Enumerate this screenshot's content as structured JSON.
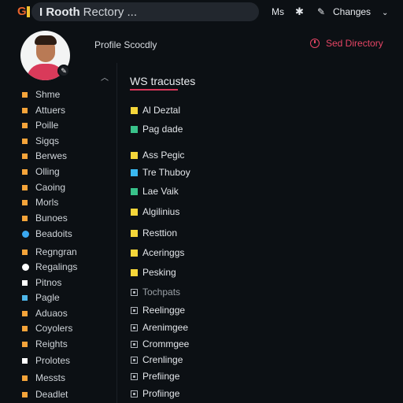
{
  "topbar": {
    "logo_letter": "G",
    "search_bold": "I Rooth",
    "search_rest": "Rectory ...",
    "ms_label": "Ms",
    "gear_icon": "gear-icon",
    "wrench_icon": "wrench-icon",
    "changes_label": "Changes",
    "chevron_icon": "chevron-down-icon"
  },
  "profile": {
    "label": "Profile Scocdly",
    "set_directory": "Sed Directory"
  },
  "sidebar": {
    "items": [
      {
        "label": "Shme",
        "color": "#f5a43a"
      },
      {
        "label": "Attuers",
        "color": "#f5a43a"
      },
      {
        "label": "Poille",
        "color": "#f5a43a"
      },
      {
        "label": "Sigqs",
        "color": "#f5a43a"
      },
      {
        "label": "Berwes",
        "color": "#f5a43a"
      },
      {
        "label": "Olling",
        "color": "#f5a43a"
      },
      {
        "label": "Caoing",
        "color": "#f5a43a"
      },
      {
        "label": "Morls",
        "color": "#f5a43a"
      },
      {
        "label": "Bunoes",
        "color": "#f5a43a"
      },
      {
        "label": "Beadoits",
        "color": "#3aa8f0"
      },
      {
        "label": "Regngran",
        "color": "#f5a43a"
      },
      {
        "label": "Regalings",
        "color": "#ffffff"
      },
      {
        "label": "Pitnos",
        "color": "#ffffff"
      },
      {
        "label": "Pagle",
        "color": "#4fb7ea"
      },
      {
        "label": "Aduaos",
        "color": "#f5a43a"
      },
      {
        "label": "Coyolers",
        "color": "#f5a43a"
      },
      {
        "label": "Reights",
        "color": "#f5a43a"
      },
      {
        "label": "Prolotes",
        "color": "#ffffff"
      },
      {
        "label": "Messts",
        "color": "#f5a43a"
      },
      {
        "label": "Deadlet",
        "color": "#f5a43a"
      }
    ]
  },
  "main": {
    "title": "WS tracustes",
    "items": [
      {
        "label": "Al Deztal",
        "type": "yellow"
      },
      {
        "label": "Pag dade",
        "type": "green"
      },
      {
        "label": "Ass Pegic",
        "type": "yellow"
      },
      {
        "label": "Tre Thuboy",
        "type": "cyan"
      },
      {
        "label": "Lae Vaik",
        "type": "green"
      },
      {
        "label": "Algilinius",
        "type": "yellow"
      },
      {
        "label": "Resttion",
        "type": "yellow"
      },
      {
        "label": "Aceringgs",
        "type": "yellow"
      },
      {
        "label": "Pesking",
        "type": "yellow"
      },
      {
        "label": "Tochpats",
        "type": "box-muted"
      },
      {
        "label": "Reelingge",
        "type": "box"
      },
      {
        "label": "Arenimgee",
        "type": "box"
      },
      {
        "label": "Crommgee",
        "type": "box"
      },
      {
        "label": "Crenlinge",
        "type": "box"
      },
      {
        "label": "Prefiinge",
        "type": "box"
      },
      {
        "label": "Profiinge",
        "type": "box"
      }
    ]
  },
  "colors": {
    "accent": "#e64565",
    "yellow": "#f5d63a",
    "green": "#39c28a",
    "cyan": "#3ab8f0"
  }
}
